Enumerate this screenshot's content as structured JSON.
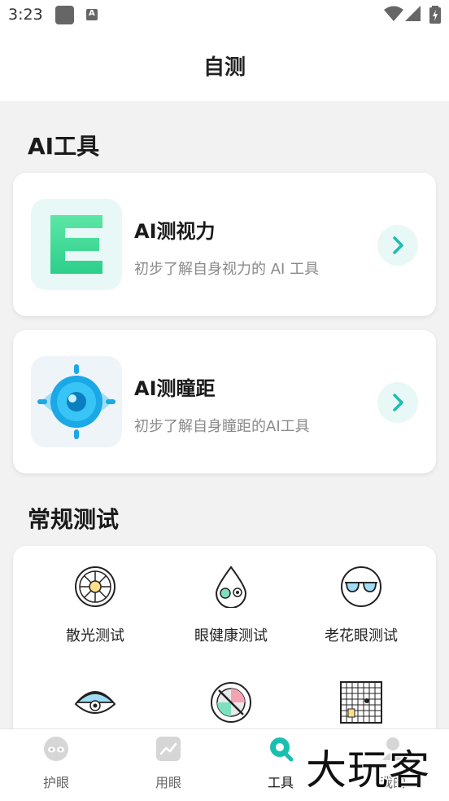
{
  "status_bar": {
    "time": "3:23"
  },
  "header": {
    "title": "自测"
  },
  "ai_section": {
    "title": "AI工具",
    "tools": [
      {
        "name": "AI测视力",
        "desc": "初步了解自身视力的 AI 工具",
        "icon": "letter-e-icon"
      },
      {
        "name": "AI测瞳距",
        "desc": "初步了解自身瞳距的AI工具",
        "icon": "eye-target-icon"
      }
    ]
  },
  "tests_section": {
    "title": "常规测试",
    "items": [
      {
        "label": "散光测试",
        "icon": "astigmatism-dial-icon"
      },
      {
        "label": "眼健康测试",
        "icon": "eye-drop-icon"
      },
      {
        "label": "老花眼测试",
        "icon": "glasses-icon"
      },
      {
        "label": "",
        "icon": "closed-eye-icon"
      },
      {
        "label": "",
        "icon": "color-blind-icon"
      },
      {
        "label": "",
        "icon": "amsler-grid-icon"
      }
    ]
  },
  "bottom_nav": {
    "items": [
      {
        "label": "护眼",
        "icon": "eye-mask-icon",
        "active": false
      },
      {
        "label": "用眼",
        "icon": "chart-icon",
        "active": false
      },
      {
        "label": "工具",
        "icon": "search-icon",
        "active": true
      },
      {
        "label": "我的",
        "icon": "profile-icon",
        "active": false
      }
    ]
  },
  "watermark": {
    "text": "大玩客"
  },
  "colors": {
    "accent": "#1bbfb0",
    "card_bg": "#ffffff",
    "page_bg": "#f2f2f2"
  }
}
